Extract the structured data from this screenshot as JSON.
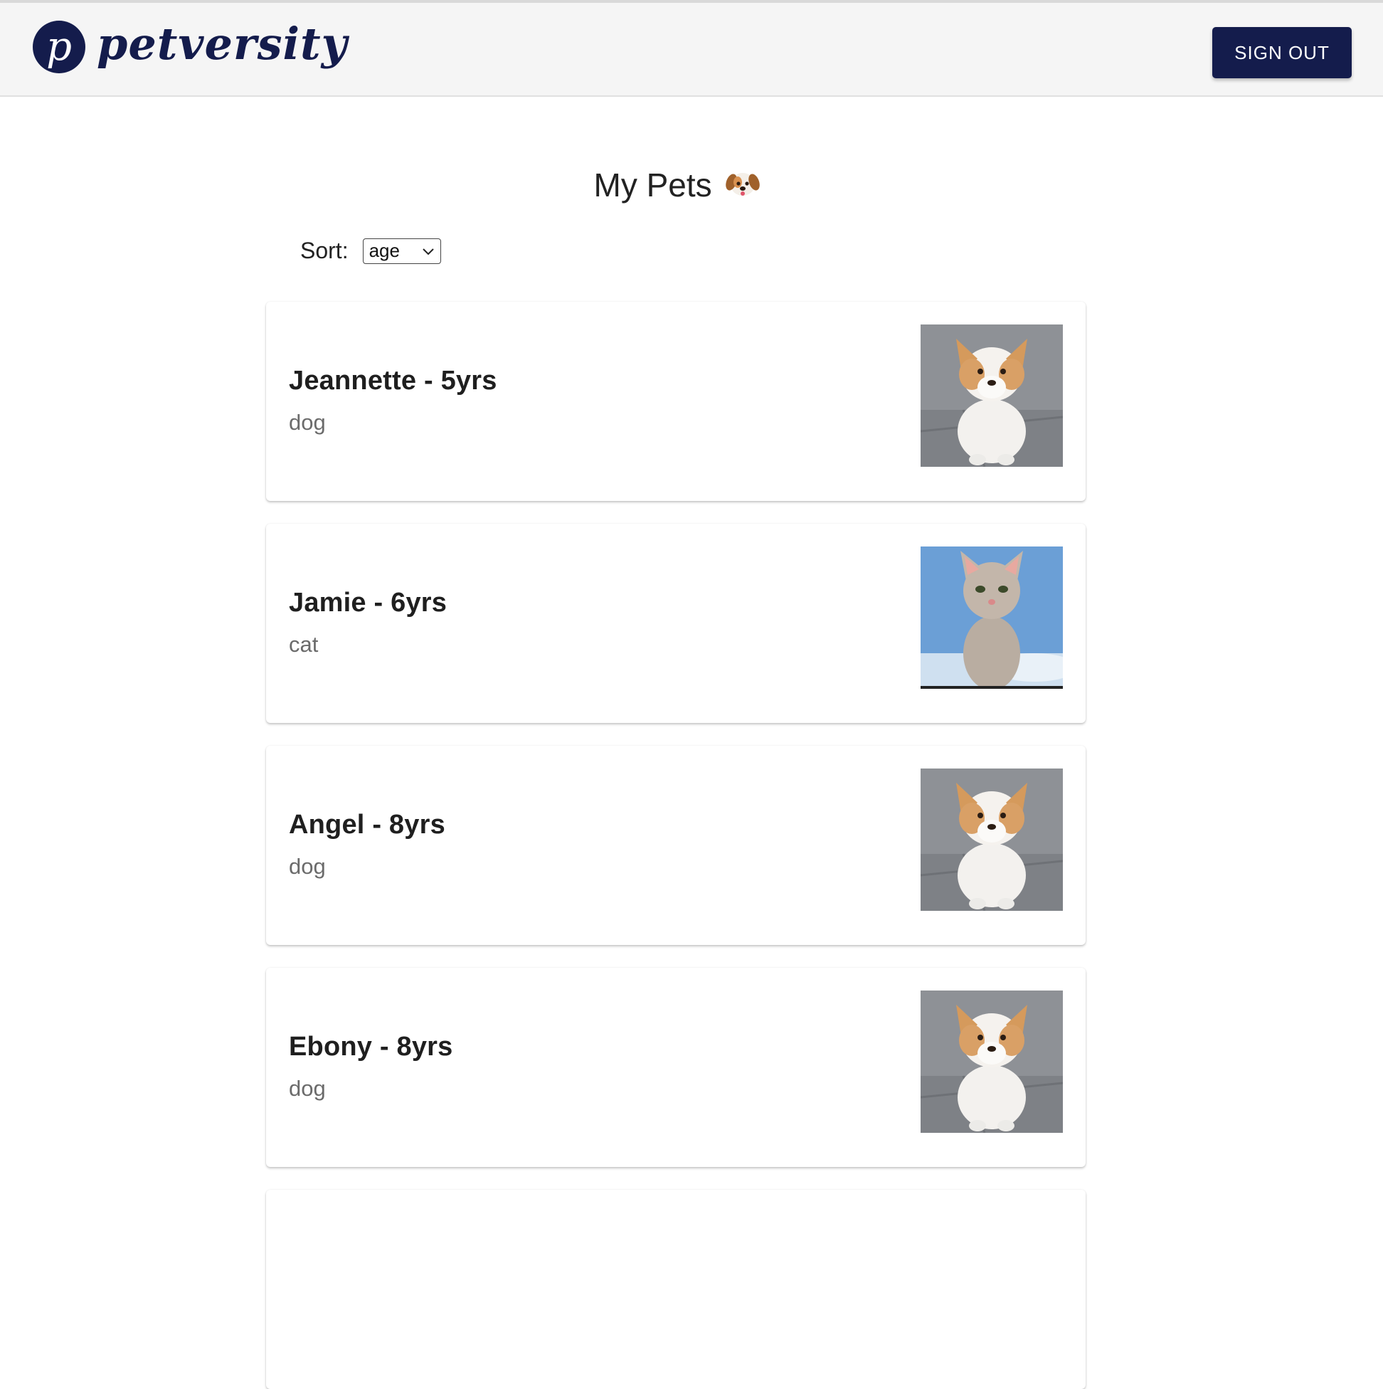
{
  "header": {
    "logo_mark": "p",
    "logo_text": "petversity",
    "signout_label": "SIGN OUT"
  },
  "page": {
    "title": "My Pets",
    "title_emoji": "dog-face-icon"
  },
  "sort": {
    "label": "Sort:",
    "selected": "age"
  },
  "pets": [
    {
      "name": "Jeannette - 5yrs",
      "species": "dog",
      "photo": "dog-photo"
    },
    {
      "name": "Jamie - 6yrs",
      "species": "cat",
      "photo": "cat-photo"
    },
    {
      "name": "Angel - 8yrs",
      "species": "dog",
      "photo": "dog-photo"
    },
    {
      "name": "Ebony - 8yrs",
      "species": "dog",
      "photo": "dog-photo"
    }
  ],
  "colors": {
    "brand": "#141c4c",
    "header_bg": "#f5f5f5"
  }
}
